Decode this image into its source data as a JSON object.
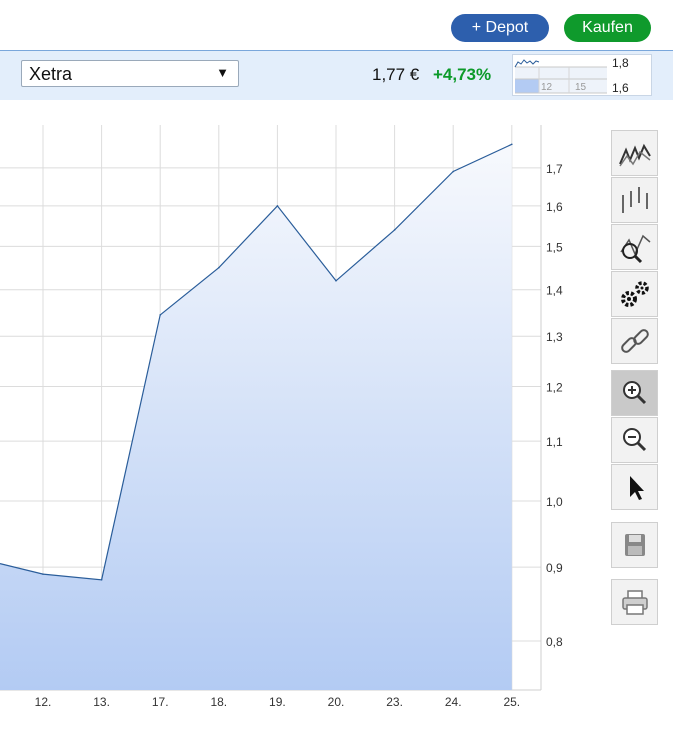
{
  "header": {
    "depot_label": "+ Depot",
    "buy_label": "Kaufen"
  },
  "quote": {
    "exchange": "Xetra",
    "price": "1,77 €",
    "change": "+4,73%"
  },
  "mini_chart": {
    "y_labels": [
      "1,8",
      "1,6"
    ],
    "x_labels": [
      "12",
      "15"
    ]
  },
  "toolbar": {
    "tools": [
      {
        "name": "line-chart-icon"
      },
      {
        "name": "ohlc-chart-icon"
      },
      {
        "name": "indicator-search-icon"
      },
      {
        "name": "settings-gears-icon"
      },
      {
        "name": "link-icon"
      },
      {
        "name": "zoom-in-icon",
        "active": true
      },
      {
        "name": "zoom-out-icon"
      },
      {
        "name": "pointer-icon"
      },
      {
        "name": "save-icon"
      },
      {
        "name": "print-icon"
      }
    ]
  },
  "colors": {
    "line": "#2a5d9a",
    "fill_top": "#f7f9fd",
    "fill_bottom": "#b3cbf3",
    "grid": "#dcdcdc",
    "buy": "#0f9a2c",
    "depot": "#2d5fad",
    "positive": "#0c9a2a"
  },
  "chart_data": {
    "type": "area",
    "scale": "log",
    "x": [
      "12.",
      "13.",
      "17.",
      "18.",
      "19.",
      "20.",
      "23.",
      "24.",
      "25."
    ],
    "series": [
      {
        "values": [
          0.89,
          0.882,
          1.345,
          1.45,
          1.6,
          1.42,
          1.54,
          1.69,
          1.765
        ]
      }
    ],
    "first_value": 0.905,
    "y_ticks": [
      0.8,
      0.9,
      1.0,
      1.1,
      1.2,
      1.3,
      1.4,
      1.5,
      1.6,
      1.7
    ],
    "y_tick_labels": [
      "0,8",
      "0,9",
      "1,0",
      "1,1",
      "1,2",
      "1,3",
      "1,4",
      "1,5",
      "1,6",
      "1,7"
    ],
    "ylim": [
      0.74,
      1.82
    ],
    "grid": true,
    "title": "",
    "xlabel": "",
    "ylabel": ""
  }
}
